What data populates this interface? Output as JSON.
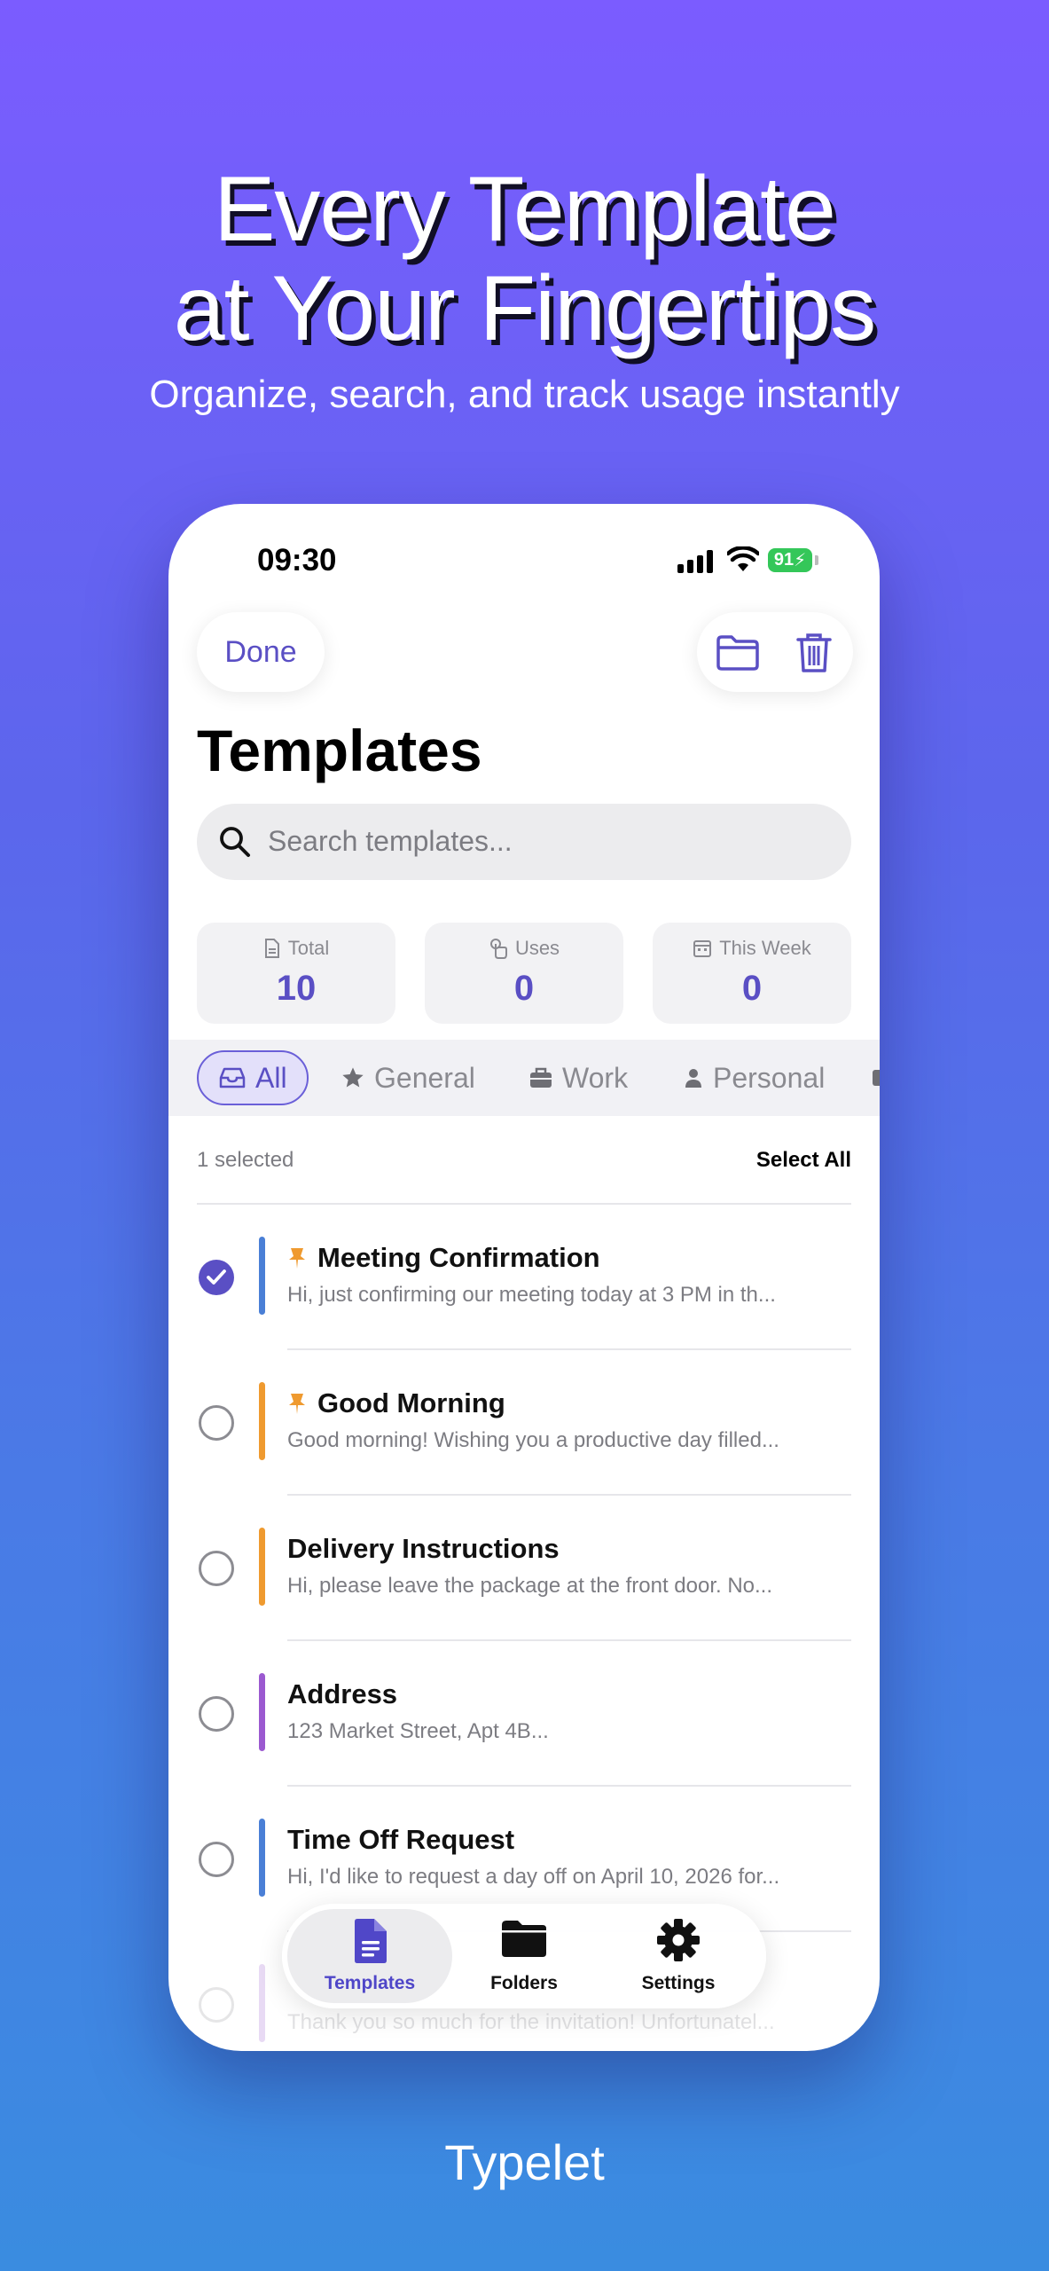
{
  "promo": {
    "headline_line1": "Every Template",
    "headline_line2": "at Your Fingertips",
    "subheadline": "Organize, search, and track usage instantly",
    "brand": "Typelet"
  },
  "status_bar": {
    "time": "09:30",
    "battery": "91"
  },
  "nav": {
    "done_label": "Done",
    "folder_icon": "folder-icon",
    "trash_icon": "trash-icon"
  },
  "page": {
    "title": "Templates"
  },
  "search": {
    "placeholder": "Search templates..."
  },
  "stats": [
    {
      "label": "Total",
      "value": "10",
      "icon": "document-icon"
    },
    {
      "label": "Uses",
      "value": "0",
      "icon": "tap-icon"
    },
    {
      "label": "This Week",
      "value": "0",
      "icon": "calendar-icon"
    }
  ],
  "categories": [
    {
      "label": "All",
      "icon": "tray-icon",
      "active": true
    },
    {
      "label": "General",
      "icon": "star-icon"
    },
    {
      "label": "Work",
      "icon": "briefcase-icon"
    },
    {
      "label": "Personal",
      "icon": "person-icon"
    }
  ],
  "selection": {
    "count_text": "1 selected",
    "select_all_label": "Select All"
  },
  "templates": [
    {
      "title": "Meeting Confirmation",
      "preview": "Hi, just confirming our meeting today at 3 PM in th...",
      "pinned": true,
      "selected": true,
      "color": "#4a7fd6"
    },
    {
      "title": "Good Morning",
      "preview": "Good morning! Wishing you a productive day filled...",
      "pinned": true,
      "selected": false,
      "color": "#ef9a2f"
    },
    {
      "title": "Delivery Instructions",
      "preview": "Hi, please leave the package at the front door. No...",
      "pinned": false,
      "selected": false,
      "color": "#ef9a2f"
    },
    {
      "title": "Address",
      "preview": "123 Market Street, Apt 4B...",
      "pinned": false,
      "selected": false,
      "color": "#9b59d0"
    },
    {
      "title": "Time Off Request",
      "preview": "Hi, I'd like to request a day off on April 10, 2026 for...",
      "pinned": false,
      "selected": false,
      "color": "#4a7fd6"
    },
    {
      "title": "",
      "preview": "Thank you so much for the invitation! Unfortunatel...",
      "pinned": false,
      "selected": false,
      "color": "#b99ad8"
    }
  ],
  "tabs": [
    {
      "label": "Templates",
      "icon": "document-icon",
      "active": true
    },
    {
      "label": "Folders",
      "icon": "folder-icon"
    },
    {
      "label": "Settings",
      "icon": "gear-icon"
    }
  ],
  "colors": {
    "accent": "#5a4fc4",
    "pin": "#ef9a2f"
  }
}
